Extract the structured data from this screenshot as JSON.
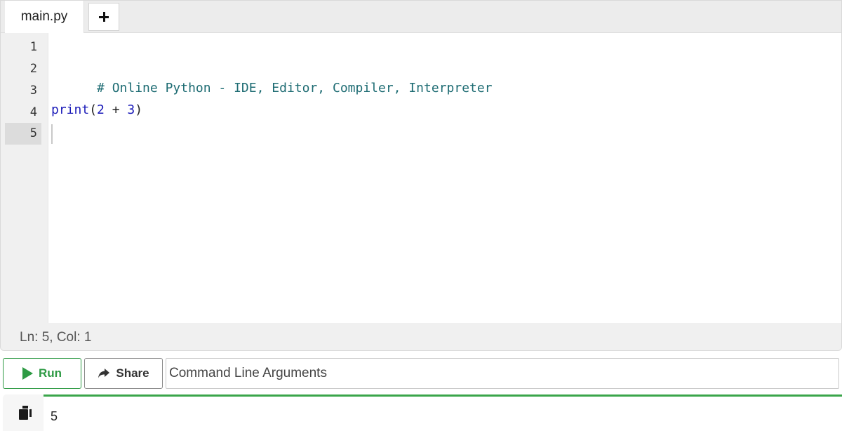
{
  "tabs": {
    "file_name": "main.py",
    "add_tab_icon": "plus-icon"
  },
  "editor": {
    "line_numbers": [
      "1",
      "2",
      "3",
      "4",
      "5"
    ],
    "active_line": 5,
    "lines": [
      {
        "comment": ""
      },
      {
        "comment": "# Online Python - IDE, Editor, Compiler, Interpreter"
      },
      {
        "comment": ""
      },
      {
        "builtin": "print",
        "open": "(",
        "num1": "2",
        "op": " + ",
        "num2": "3",
        "close": ")"
      },
      {
        "comment": ""
      }
    ],
    "colors": {
      "comment": "#1e6c73",
      "builtin": "#1a1ab8",
      "active_line_bg": "#dcdcdc"
    }
  },
  "status": {
    "text": "Ln: 5,  Col: 1"
  },
  "controls": {
    "run_label": "Run",
    "run_icon": "play-icon",
    "share_label": "Share",
    "share_icon": "share-arrow-icon",
    "args_placeholder": "Command Line Arguments",
    "accent_color": "#2e9a44"
  },
  "output": {
    "copy_icon": "copy-icon",
    "text": "5"
  }
}
